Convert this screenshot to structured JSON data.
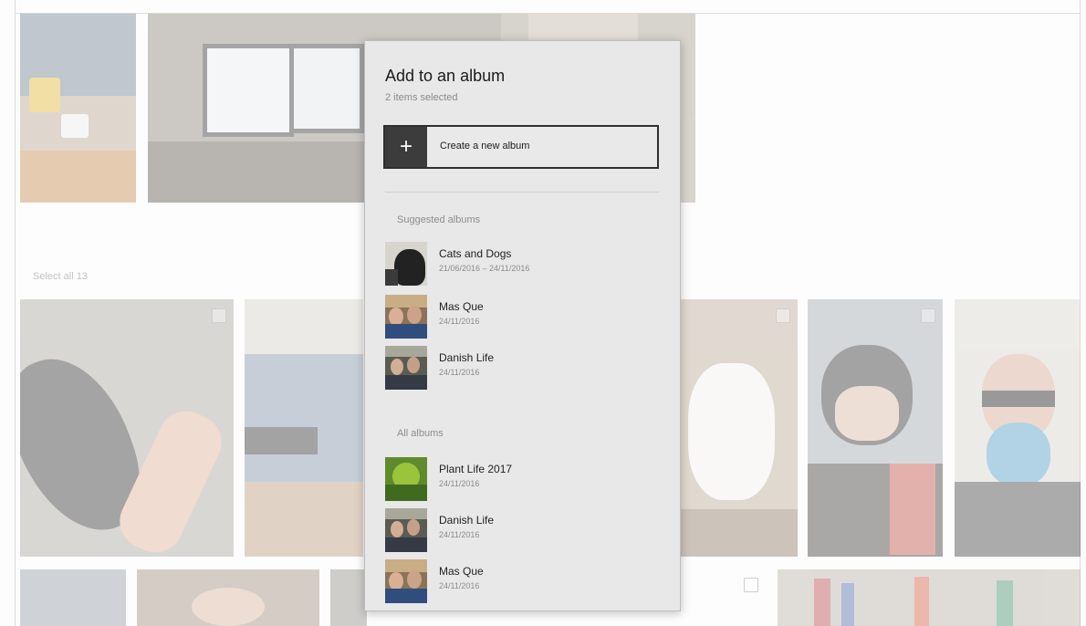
{
  "gallery": {
    "select_all_label": "Select all 13"
  },
  "flyout": {
    "title": "Add to an album",
    "subtitle": "2 items selected",
    "create_album_label": "Create a new album",
    "plus_glyph": "+",
    "suggested_heading": "Suggested albums",
    "all_heading": "All albums",
    "suggested_albums": [
      {
        "name": "Cats and Dogs",
        "date": "21/06/2016 – 24/11/2016",
        "thumb": "cat-thumbnail"
      },
      {
        "name": "Mas Que",
        "date": "24/11/2016",
        "thumb": "group-thumbnail"
      },
      {
        "name": "Danish Life",
        "date": "24/11/2016",
        "thumb": "group-thumbnail"
      }
    ],
    "all_albums": [
      {
        "name": "Plant Life 2017",
        "date": "24/11/2016",
        "thumb": "plant-thumbnail"
      },
      {
        "name": "Danish Life",
        "date": "24/11/2016",
        "thumb": "group-thumbnail"
      },
      {
        "name": "Mas Que",
        "date": "24/11/2016",
        "thumb": "group-thumbnail"
      }
    ]
  },
  "colors": {
    "flyout_background": "#e8e8e8",
    "plus_tile": "#3c3c3c",
    "button_border": "#2f2f2f"
  }
}
